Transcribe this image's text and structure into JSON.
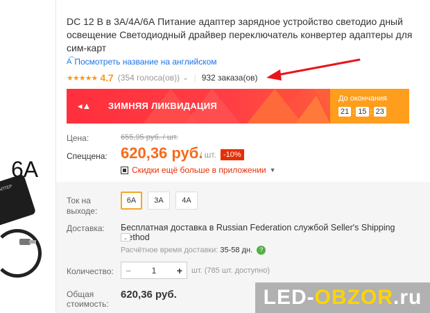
{
  "product": {
    "title": "DC 12 В в 3А/4А/6А Питание адаптер зарядное устройство светодио дный освещение Светодиодный драйвер переключатель конвертер адаптеры для сим-карт",
    "image_label": "6A",
    "adapter_label": "АДАПТЕР"
  },
  "translate_link": "Посмотреть название на английском",
  "rating": {
    "stars": "★★★★★",
    "value": "4.7",
    "votes": "(354 голоса(ов))",
    "orders": "932 заказа(ов)"
  },
  "banner": {
    "title": "ЗИМНЯЯ ЛИКВИДАЦИЯ",
    "until_label": "До окончания",
    "timer": [
      "21",
      "15",
      "23"
    ],
    "colors": {
      "main": "#ff3b3b",
      "countdown": "#ff9d1c"
    }
  },
  "price": {
    "label": "Цена:",
    "old": "655,95 руб. / шт.",
    "special_label": "Спеццена:",
    "special": "620,36 руб.",
    "per_unit": "/ шт.",
    "discount": "-10%",
    "app_discount": "Скидки ещё больше в приложении"
  },
  "options": {
    "label": "Ток на выходе:",
    "values": [
      "6A",
      "3A",
      "4A"
    ],
    "selected": "6A"
  },
  "delivery": {
    "label": "Доставка:",
    "text": "Бесплатная доставка в Russian Federation службой Seller's Shipping Method",
    "est_label": "Расчётное время доставки:",
    "est_days": "35-58 дн."
  },
  "quantity": {
    "label": "Количество:",
    "value": "1",
    "minus": "−",
    "plus": "+",
    "available": "шт. (785 шт. доступно)"
  },
  "total": {
    "label": "Общая стоимость:",
    "value": "620,36 руб."
  },
  "watermark": {
    "part1": "LED-",
    "part2": "OBZOR",
    "part3": ".ru"
  }
}
